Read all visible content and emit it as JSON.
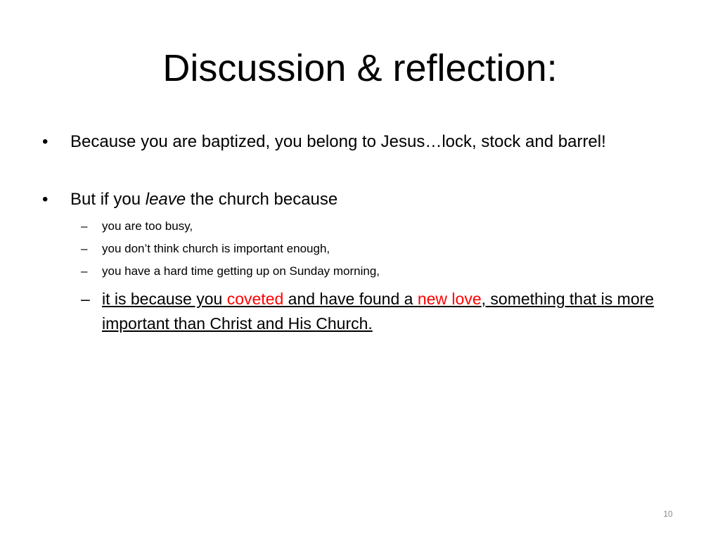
{
  "slide": {
    "title": "Discussion & reflection:",
    "bullet_glyph": "•",
    "dash_glyph": "–",
    "bullets": [
      {
        "text": "Because you are baptized, you belong to Jesus…lock, stock and barrel!"
      },
      {
        "text_before": "But if you ",
        "text_emphasis": "leave",
        "text_after": " the church because",
        "subitems": [
          "you are too busy,",
          "you don’t think church is important enough,",
          "you have a hard time getting up on Sunday morning,"
        ],
        "final_subitem": {
          "part1": "it is because you ",
          "highlight1": "coveted ",
          "part2": "and have found a ",
          "highlight2": "new love",
          "part3": ", something that is more important than Christ and His Church."
        }
      }
    ],
    "page_number": "10",
    "colors": {
      "highlight": "#ff0000",
      "page_number": "#8a8a8a"
    }
  }
}
